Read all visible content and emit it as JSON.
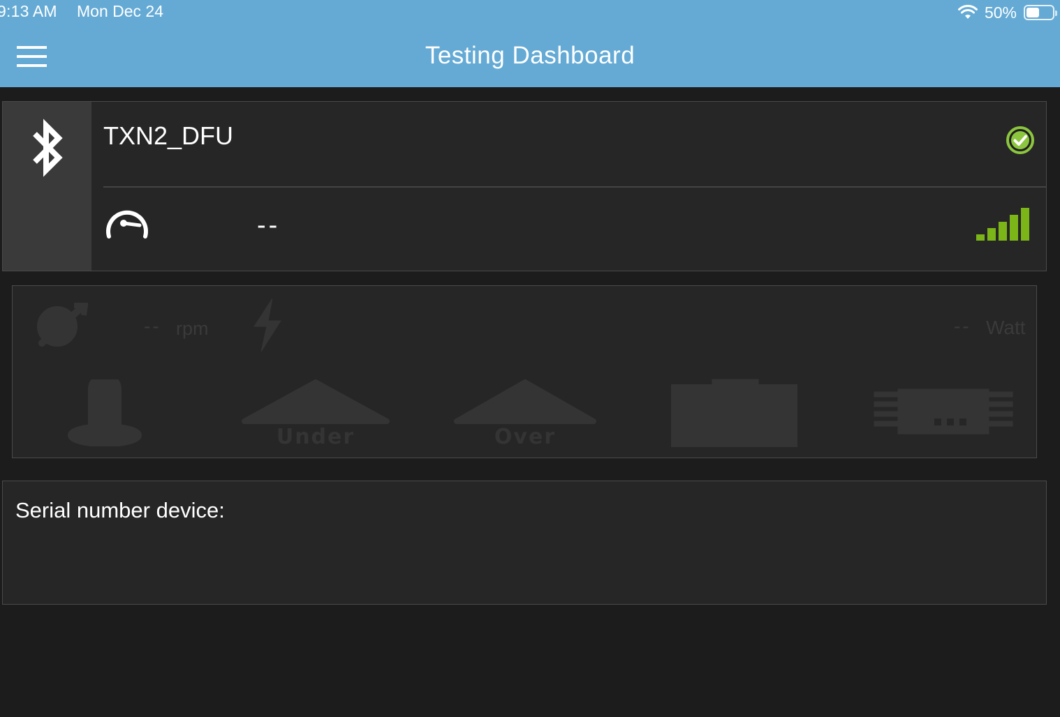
{
  "status_bar": {
    "time": "9:13 AM",
    "date": "Mon Dec 24",
    "battery_percent": "50%",
    "battery_level": 0.5
  },
  "nav": {
    "title": "Testing Dashboard",
    "menu_icon": "hamburger-menu-icon"
  },
  "device": {
    "connection_icon": "bluetooth-icon",
    "name": "TXN2_DFU",
    "status_icon": "connected-check-icon",
    "status_color": "#8cc63f",
    "speed_icon": "speedometer-icon",
    "speed_value": "--",
    "signal_icon": "signal-strength-icon",
    "signal_bars_active": 5,
    "signal_color": "#7cb518"
  },
  "metrics": {
    "rpm_icon": "motor-rpm-icon",
    "rpm_value": "--",
    "rpm_unit": "rpm",
    "power_icon": "lightning-icon",
    "watt_value": "--",
    "watt_unit": "Watt",
    "indicators": [
      {
        "icon": "temperature-icon"
      },
      {
        "icon": "undervoltage-icon",
        "label": "Under"
      },
      {
        "icon": "overvoltage-icon",
        "label": "Over"
      },
      {
        "icon": "battery-charge-icon"
      },
      {
        "icon": "chip-icon"
      }
    ]
  },
  "serial": {
    "label": "Serial number device:",
    "value": ""
  }
}
